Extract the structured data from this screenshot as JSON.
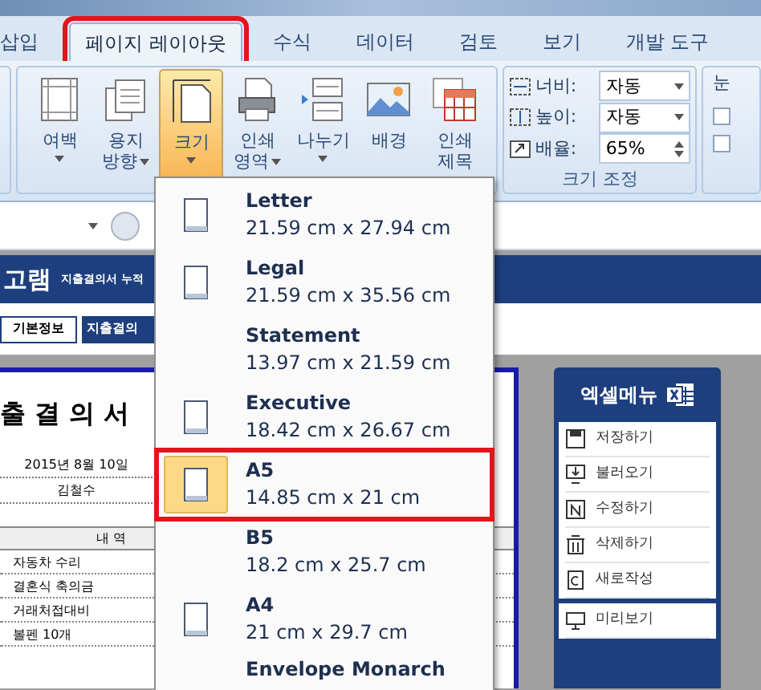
{
  "tabs": [
    {
      "label": "삽입",
      "selected": false,
      "marked": false
    },
    {
      "label": "페이지 레이아웃",
      "selected": true,
      "marked": true
    },
    {
      "label": "수식",
      "selected": false,
      "marked": false
    },
    {
      "label": "데이터",
      "selected": false,
      "marked": false
    },
    {
      "label": "검토",
      "selected": false,
      "marked": false
    },
    {
      "label": "보기",
      "selected": false,
      "marked": false
    },
    {
      "label": "개발 도구",
      "selected": false,
      "marked": false
    }
  ],
  "page_setup": {
    "buttons": [
      {
        "kind": "margins",
        "lines": [
          "여백"
        ],
        "dropdown": true,
        "active": false
      },
      {
        "kind": "orientation",
        "lines": [
          "용지",
          "방향"
        ],
        "dropdown": true,
        "active": false
      },
      {
        "kind": "size",
        "lines": [
          "크기"
        ],
        "dropdown": true,
        "active": true
      },
      {
        "kind": "print_area",
        "lines": [
          "인쇄",
          "영역"
        ],
        "dropdown": true,
        "active": false
      },
      {
        "kind": "breaks",
        "lines": [
          "나누기"
        ],
        "dropdown": true,
        "active": false
      },
      {
        "kind": "background",
        "lines": [
          "배경"
        ],
        "dropdown": false,
        "active": false
      },
      {
        "kind": "print_titles",
        "lines": [
          "인쇄",
          "제목"
        ],
        "dropdown": false,
        "active": false
      }
    ]
  },
  "scale_to_fit": {
    "title": "크기 조정",
    "fields": [
      {
        "kind": "width",
        "label": "너비:",
        "value": "자동"
      },
      {
        "kind": "height",
        "label": "높이:",
        "value": "자동"
      },
      {
        "kind": "scale",
        "label": "배율:",
        "value": "65%"
      }
    ]
  },
  "gridlines": {
    "label": "눈",
    "checkboxes": [
      {
        "checked": false
      },
      {
        "checked": false
      }
    ]
  },
  "sheet": {
    "banner_title": "고램",
    "banner_subtitle": "지출결의서 누적",
    "tabs": [
      {
        "label": "기본정보",
        "selected": true
      },
      {
        "label": "지출결의",
        "selected": false
      }
    ],
    "doc_title": "출 결 의 서",
    "info": [
      "2015년 8월 10일",
      "김철수"
    ],
    "column_header": "내 역",
    "items": [
      "자동차 수리",
      "결혼식 축의금",
      "거래처접대비",
      "볼펜 10개"
    ]
  },
  "excel_menu": {
    "title": "엑셀메뉴",
    "groups": [
      [
        {
          "kind": "save",
          "label": "저장하기"
        },
        {
          "kind": "load",
          "label": "불러오기"
        },
        {
          "kind": "edit",
          "label": "수정하기"
        },
        {
          "kind": "delete",
          "label": "삭제하기"
        },
        {
          "kind": "new",
          "label": "새로작성"
        }
      ],
      [
        {
          "kind": "preview",
          "label": "미리보기"
        }
      ]
    ]
  },
  "size_menu": {
    "items": [
      {
        "name": "Letter",
        "size": "21.59 cm x 27.94 cm",
        "icon": true,
        "selected": false,
        "marked": false
      },
      {
        "name": "Legal",
        "size": "21.59 cm x 35.56 cm",
        "icon": true,
        "selected": false,
        "marked": false
      },
      {
        "name": "Statement",
        "size": "13.97 cm x 21.59 cm",
        "icon": false,
        "selected": false,
        "marked": false
      },
      {
        "name": "Executive",
        "size": "18.42 cm x 26.67 cm",
        "icon": true,
        "selected": false,
        "marked": false
      },
      {
        "name": "A5",
        "size": "14.85 cm x 21 cm",
        "icon": true,
        "selected": true,
        "marked": true
      },
      {
        "name": "B5",
        "size": "18.2 cm x 25.7 cm",
        "icon": false,
        "selected": false,
        "marked": false
      },
      {
        "name": "A4",
        "size": "21 cm x 29.7 cm",
        "icon": true,
        "selected": false,
        "marked": false
      },
      {
        "name": "Envelope Monarch",
        "icon": false,
        "selected": false,
        "marked": false
      }
    ]
  }
}
